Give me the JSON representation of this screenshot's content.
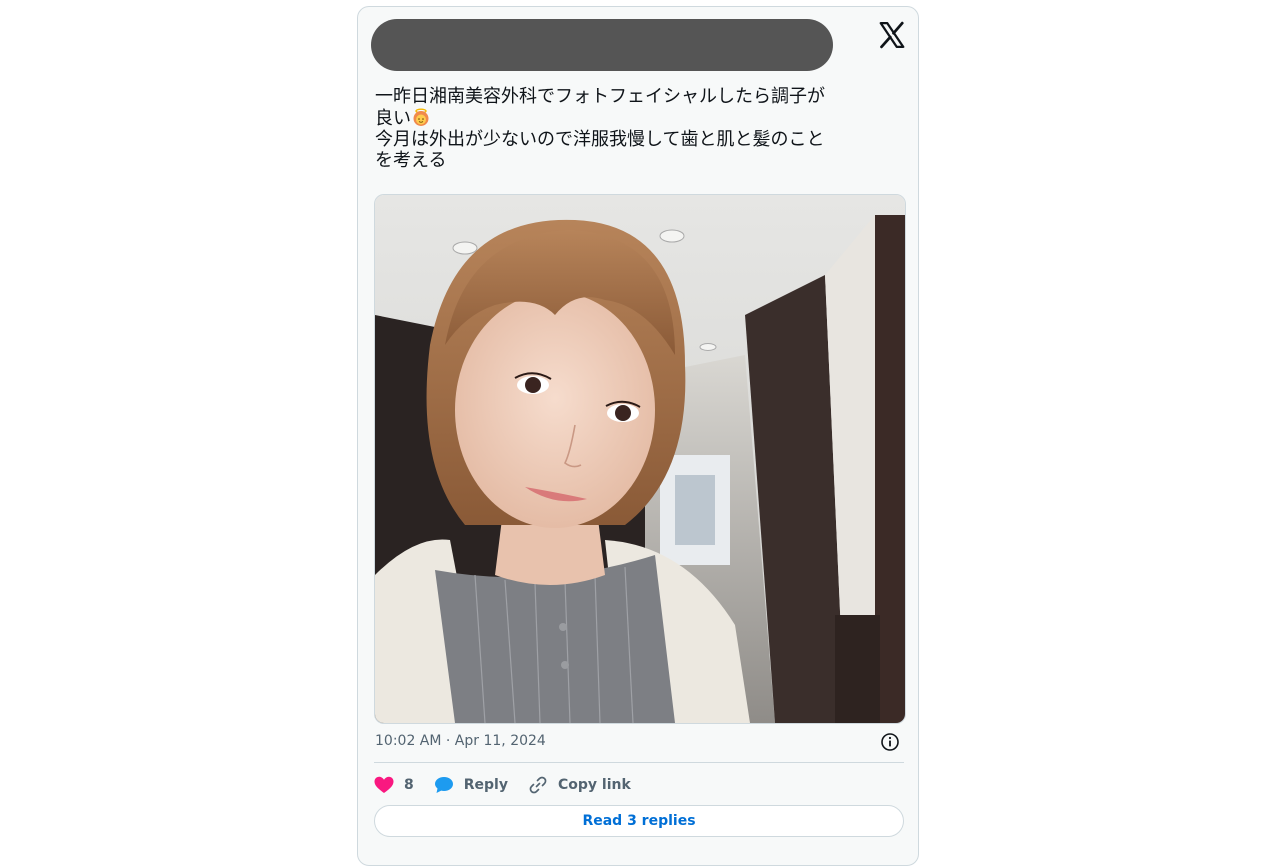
{
  "tweet": {
    "text_line1": "一昨日湘南美容外科でフォトフェイシャルしたら調子が",
    "text_line2_prefix": "良い",
    "text_line3": "今月は外出が少ないので洋服我慢して歯と肌と髪のこと",
    "text_line4": "を考える",
    "emoji_name": "woman-with-halo-emoji",
    "timestamp": "10:02 AM · Apr 11, 2024"
  },
  "actions": {
    "like_count": "8",
    "reply_label": "Reply",
    "copy_link_label": "Copy link",
    "read_replies_label": "Read 3 replies"
  },
  "icons": {
    "logo": "x-logo-icon",
    "info": "info-icon",
    "like": "heart-icon",
    "reply": "speech-bubble-icon",
    "copy": "link-icon"
  },
  "colors": {
    "heart": "#f91880",
    "reply_bubble": "#1d9bf0",
    "link_blue": "#006fd6",
    "secondary_text": "#536471",
    "header_redaction": "#555555"
  }
}
